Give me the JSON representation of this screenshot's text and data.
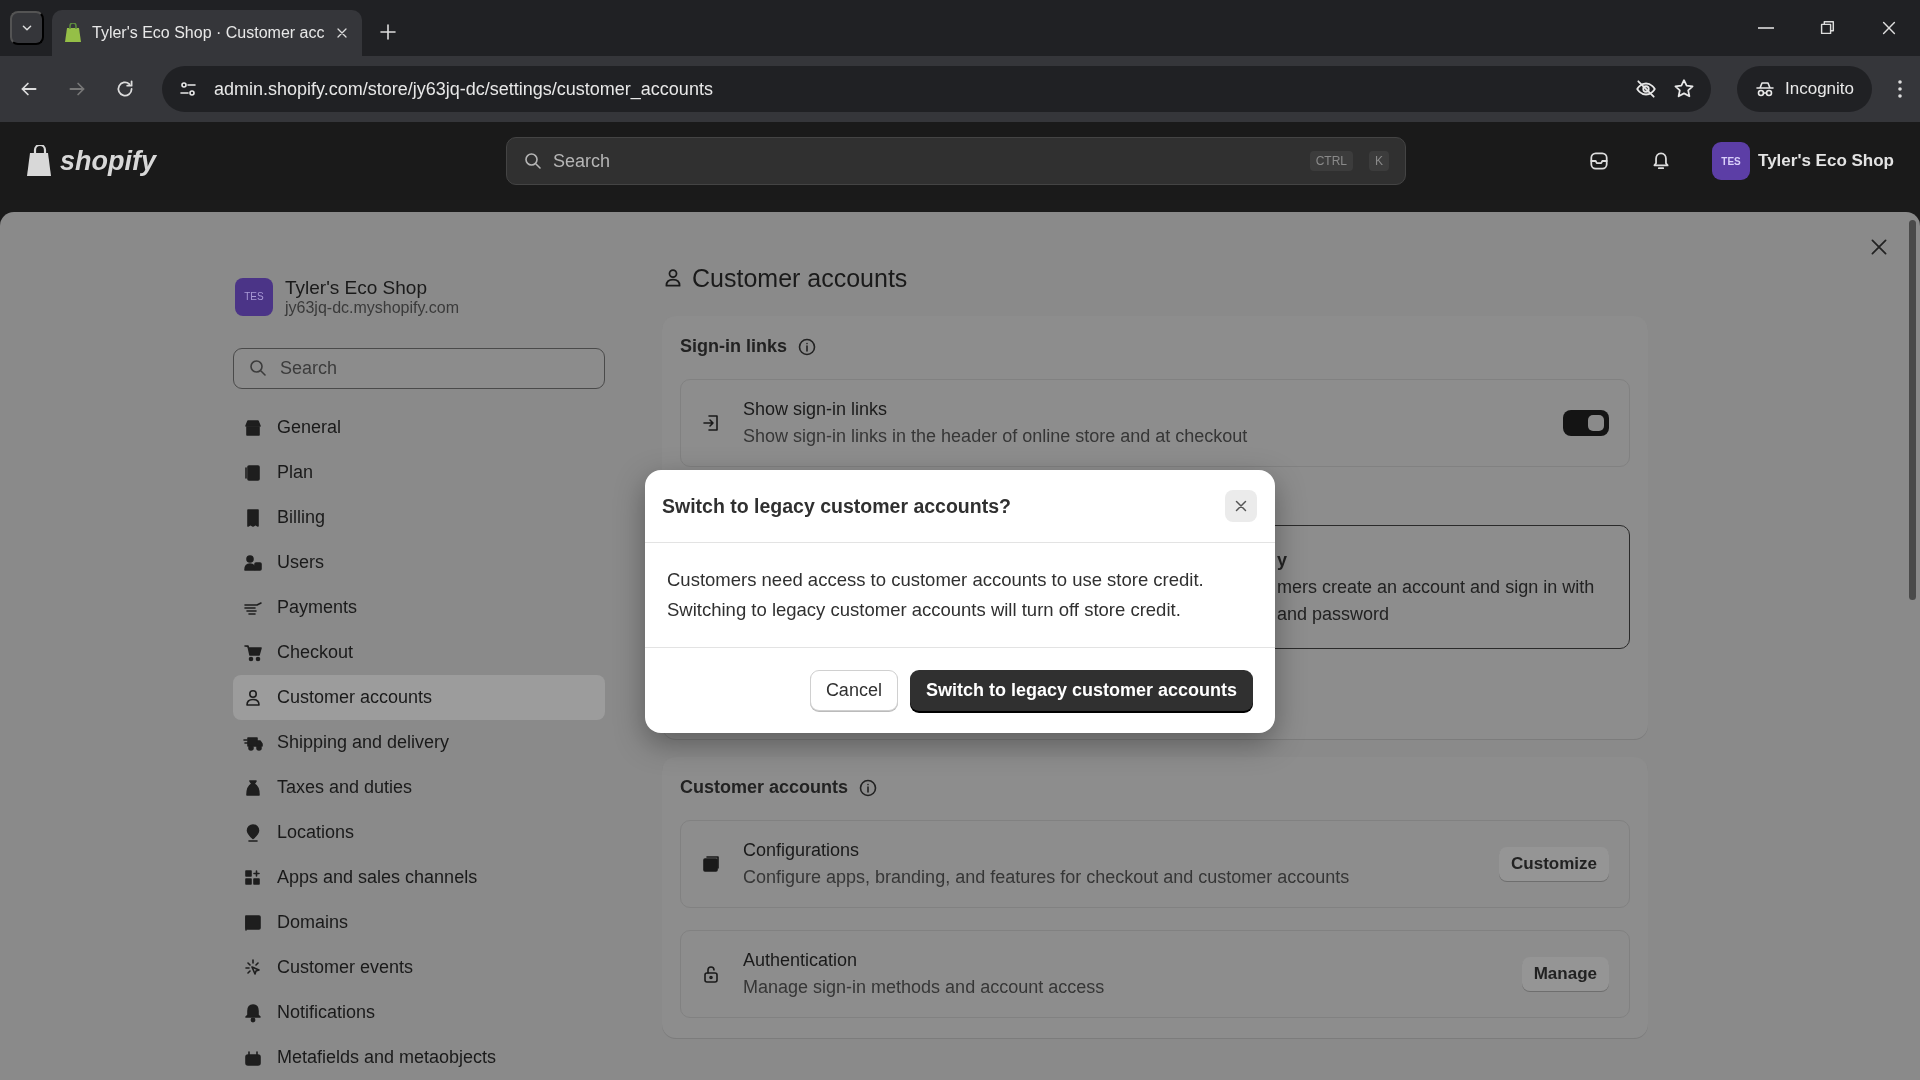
{
  "browser": {
    "tab_title": "Tyler's Eco Shop · Customer acc",
    "url": "admin.shopify.com/store/jy63jq-dc/settings/customer_accounts",
    "profile_label": "Incognito"
  },
  "topbar": {
    "logo": "shopify",
    "search_placeholder": "Search",
    "shortcut": [
      "CTRL",
      "K"
    ],
    "store_initials": "TES",
    "store_name": "Tyler's Eco Shop"
  },
  "sidebar": {
    "store_initials": "TES",
    "store_name": "Tyler's Eco Shop",
    "store_domain": "jy63jq-dc.myshopify.com",
    "search_placeholder": "Search",
    "items": [
      {
        "label": "General",
        "selected": false
      },
      {
        "label": "Plan",
        "selected": false
      },
      {
        "label": "Billing",
        "selected": false
      },
      {
        "label": "Users",
        "selected": false
      },
      {
        "label": "Payments",
        "selected": false
      },
      {
        "label": "Checkout",
        "selected": false
      },
      {
        "label": "Customer accounts",
        "selected": true
      },
      {
        "label": "Shipping and delivery",
        "selected": false
      },
      {
        "label": "Taxes and duties",
        "selected": false
      },
      {
        "label": "Locations",
        "selected": false
      },
      {
        "label": "Apps and sales channels",
        "selected": false
      },
      {
        "label": "Domains",
        "selected": false
      },
      {
        "label": "Customer events",
        "selected": false
      },
      {
        "label": "Notifications",
        "selected": false
      },
      {
        "label": "Metafields and metaobjects",
        "selected": false
      }
    ]
  },
  "page": {
    "title": "Customer accounts",
    "sign_in_links": {
      "heading": "Sign-in links",
      "title": "Show sign-in links",
      "description": "Show sign-in links in the header of online store and at checkout",
      "on": true
    },
    "legacy_option": {
      "title_fragment": "y",
      "lines": [
        "mers create an account and sign in with",
        "and password"
      ],
      "selected": true
    },
    "customer_accounts": {
      "heading": "Customer accounts",
      "rows": [
        {
          "title": "Configurations",
          "description": "Configure apps, branding, and features for checkout and customer accounts",
          "action": "Customize"
        },
        {
          "title": "Authentication",
          "description": "Manage sign-in methods and account access",
          "action": "Manage"
        }
      ]
    }
  },
  "dialog": {
    "title": "Switch to legacy customer accounts?",
    "message": [
      "Customers need access to customer accounts to use store credit.",
      "Switching to legacy customer accounts will turn off store credit."
    ],
    "cancel": "Cancel",
    "confirm": "Switch to legacy customer accounts"
  }
}
